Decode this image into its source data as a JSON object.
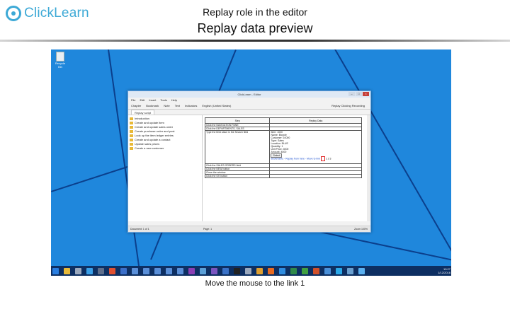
{
  "brand": {
    "logo_text": "ClickLearn"
  },
  "slide": {
    "title": "Replay role in the editor",
    "subtitle": "Replay data preview",
    "caption": "Move the mouse to the link 1"
  },
  "desktop": {
    "recycle_bin_label": "Recycle Bin",
    "window": {
      "title": "ClickLearn - Editor",
      "menu": [
        "File",
        "Edit",
        "Insert",
        "Tools",
        "Help"
      ],
      "toolbar": [
        "Chapter",
        "Bookmark",
        "Note",
        "Text",
        "Indicators",
        "English (United States)"
      ],
      "toolbar_right": "Replay Clicking Recording",
      "tab_label": "Replay script",
      "tree_items": [
        "Introduction",
        "Create and update item",
        "Create and update sales order",
        "Create purchase order and post",
        "Look up the item ledger entries",
        "Create and update a contact",
        "Update sales prices",
        "Create a new customer"
      ],
      "table": {
        "headers": [
          "Step",
          "Replay Data"
        ],
        "rows": [
          {
            "step": "Click the NAVIGATION PANE",
            "data": []
          },
          {
            "step": "Click the DEPARTMENTS, SALES",
            "data": []
          },
          {
            "step": "Type the field value in the Search field",
            "data": [
              "Item: 1000",
              "Name: Bicycle",
              "Customer: 10000",
              "Type: Sales",
              "Location: BLUE",
              "Quantity: 1",
              "Unit Price: 4000",
              "Amount: 4000"
            ],
            "button": "Select",
            "link": "Bookmarks - Replay from here - Move to link",
            "link_suffix": "1 2 3"
          },
          {
            "step": "Click the SALES ORDERS field",
            "data": []
          },
          {
            "step": "Click the NEW button",
            "data": []
          },
          {
            "step": "Close the window",
            "data": []
          },
          {
            "step": "Click the OK button",
            "data": []
          }
        ]
      },
      "status": {
        "left": "Document: 1 of 1",
        "mid": "Page: 1",
        "right": "Zoom 100%"
      }
    },
    "taskbar": {
      "icons": [
        {
          "name": "start-icon",
          "color": "#2a7ee0"
        },
        {
          "name": "file-explorer-icon",
          "color": "#e8b938"
        },
        {
          "name": "sql-icon",
          "color": "#9aa8bd"
        },
        {
          "name": "store-icon",
          "color": "#3aa0e8"
        },
        {
          "name": "app-1-icon",
          "color": "#5f6f8c"
        },
        {
          "name": "app-2-icon",
          "color": "#e05030"
        },
        {
          "name": "word-icon",
          "color": "#3b6fc9"
        },
        {
          "name": "chart-icon",
          "color": "#5a8fd8"
        },
        {
          "name": "chart-icon",
          "color": "#5a8fd8"
        },
        {
          "name": "chart-icon",
          "color": "#5a8fd8"
        },
        {
          "name": "chart-icon",
          "color": "#5a8fd8"
        },
        {
          "name": "chart-icon",
          "color": "#5a8fd8"
        },
        {
          "name": "onenote-icon",
          "color": "#8b3fb4"
        },
        {
          "name": "app-3-icon",
          "color": "#5ba0d8"
        },
        {
          "name": "visual-studio-icon",
          "color": "#7a55c0"
        },
        {
          "name": "app-4-icon",
          "color": "#3a72c8"
        },
        {
          "name": "cmd-icon",
          "color": "#222222"
        },
        {
          "name": "media-icon",
          "color": "#9aa8bd"
        },
        {
          "name": "chrome-icon",
          "color": "#e0a030"
        },
        {
          "name": "firefox-icon",
          "color": "#e86a20"
        },
        {
          "name": "ie-icon",
          "color": "#2f8de0"
        },
        {
          "name": "excel-icon",
          "color": "#2f8a4a"
        },
        {
          "name": "project-icon",
          "color": "#40a040"
        },
        {
          "name": "powerpoint-icon",
          "color": "#d0502a"
        },
        {
          "name": "app-5-icon",
          "color": "#4a90d8"
        },
        {
          "name": "skype-icon",
          "color": "#2aa8e8"
        },
        {
          "name": "app-6-icon",
          "color": "#6aa0d0"
        },
        {
          "name": "app-7-icon",
          "color": "#5ab0f0"
        }
      ],
      "clock_time": "10:27",
      "clock_date": "1/12/2016"
    }
  }
}
